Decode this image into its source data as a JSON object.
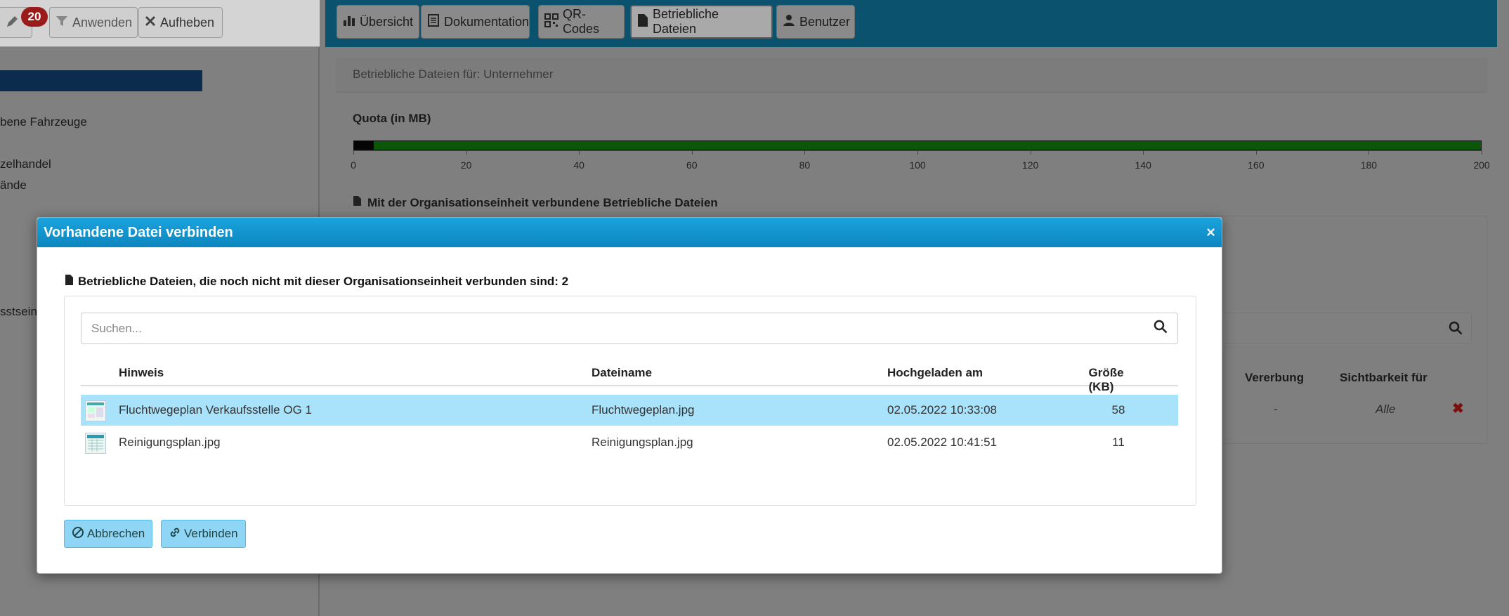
{
  "toolbar": {
    "badge_count": "20",
    "apply_label": "Anwenden",
    "cancel_label": "Aufheben"
  },
  "left_nav": {
    "items": [
      "bene Fahrzeuge",
      "zelhandel",
      "ände",
      "sstsein"
    ]
  },
  "tabs": [
    {
      "label": "Übersicht",
      "icon": "bar-chart-icon"
    },
    {
      "label": "Dokumentation",
      "icon": "document-icon"
    },
    {
      "label": "QR-Codes",
      "icon": "qr-code-icon"
    },
    {
      "label": "Betriebliche Dateien",
      "icon": "file-icon",
      "active": true
    },
    {
      "label": "Benutzer",
      "icon": "user-icon"
    }
  ],
  "page": {
    "subtitle": "Betriebliche Dateien für: Unternehmer",
    "quota_title": "Quota (in MB)",
    "quota": {
      "used_mb": 3.5,
      "max_mb": 200,
      "ticks": [
        "0",
        "20",
        "40",
        "60",
        "80",
        "100",
        "120",
        "140",
        "160",
        "180",
        "200"
      ]
    },
    "linked_title": "Mit der Organisationseinheit verbundene Betriebliche Dateien",
    "bg_table_headers": [
      "Vererbung",
      "Sichtbarkeit für"
    ],
    "bg_row": {
      "inheritance": "-",
      "visibility": "Alle"
    }
  },
  "modal": {
    "title": "Vorhandene Datei verbinden",
    "close": "×",
    "section_title": "Betriebliche Dateien, die noch nicht mit dieser Organisationseinheit verbunden sind: 2",
    "search_placeholder": "Suchen...",
    "columns": [
      "Hinweis",
      "Dateiname",
      "Hochgeladen am",
      "Größe (KB)"
    ],
    "rows": [
      {
        "hint": "Fluchtwegeplan Verkaufsstelle OG 1",
        "filename": "Fluchtwegeplan.jpg",
        "uploaded": "02.05.2022 10:33:08",
        "size": "58",
        "selected": true
      },
      {
        "hint": "Reinigungsplan.jpg",
        "filename": "Reinigungsplan.jpg",
        "uploaded": "02.05.2022 10:41:51",
        "size": "11",
        "selected": false
      }
    ],
    "cancel_label": "Abbrechen",
    "connect_label": "Verbinden"
  },
  "colors": {
    "header_blue": "#0d86bf",
    "selected_row": "#a9e2fb",
    "button_blue": "#8fd6f6",
    "quota_green": "#0a570a"
  }
}
